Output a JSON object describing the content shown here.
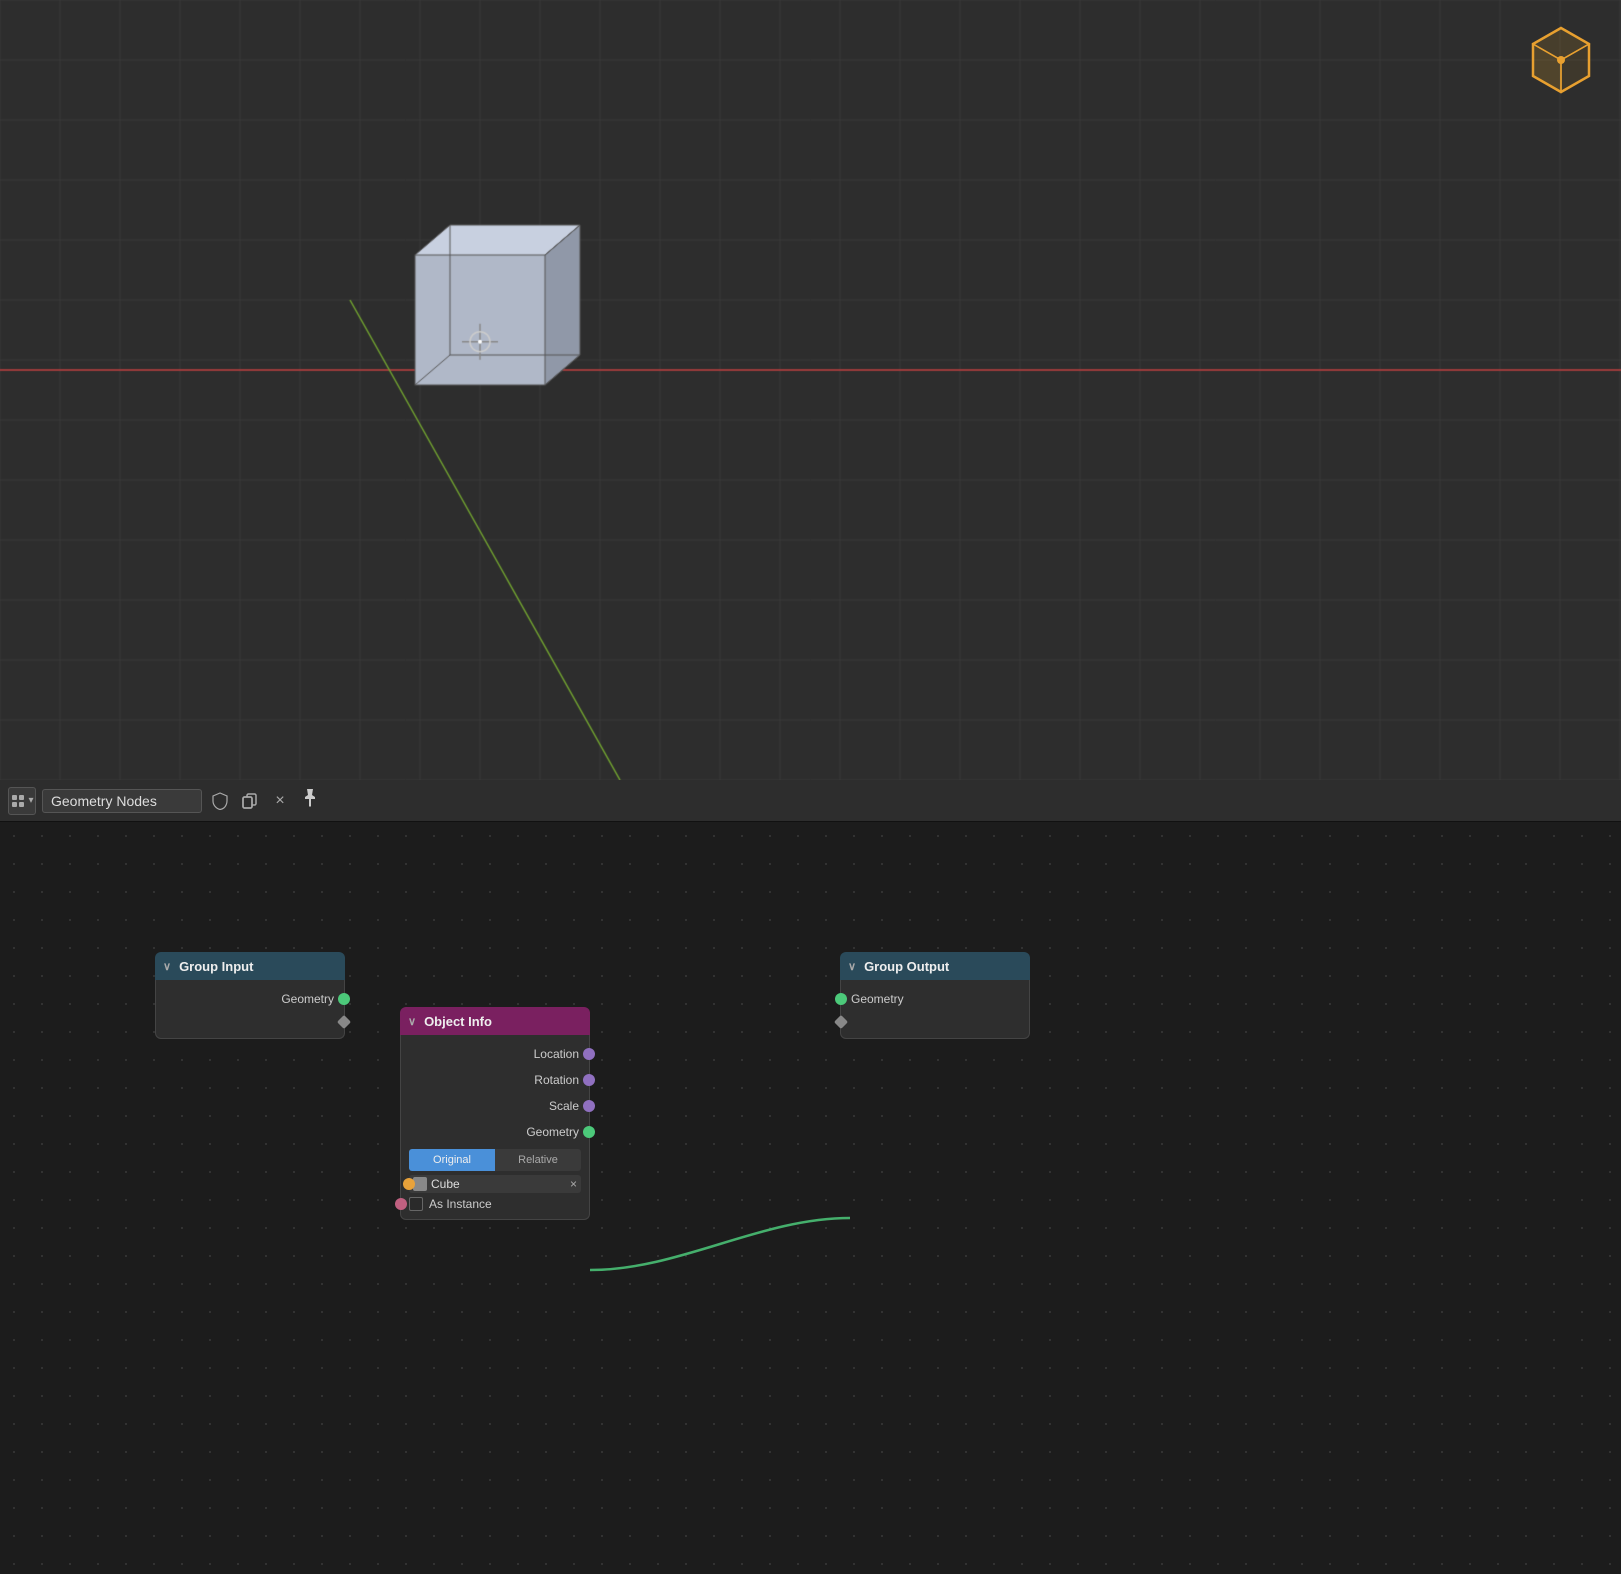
{
  "viewport": {
    "background_color": "#2a2a2a",
    "grid_color": "#3a3a3a",
    "axis_x_color": "#c04040",
    "axis_y_color": "#70a030",
    "axis_z_color": "#4060c0"
  },
  "node_editor": {
    "header": {
      "editor_type_label": "🖧",
      "nodetree_name": "Geometry Nodes",
      "shield_icon": "🛡",
      "copy_icon": "⧉",
      "close_icon": "×",
      "pin_icon": "📌"
    },
    "nodes": {
      "group_input": {
        "title": "Group Input",
        "chevron": "∨",
        "output_geometry_label": "Geometry",
        "output_extra_label": ""
      },
      "group_output": {
        "title": "Group Output",
        "chevron": "∨",
        "input_geometry_label": "Geometry",
        "input_extra_label": ""
      },
      "object_info": {
        "title": "Object Info",
        "chevron": "∨",
        "output_location_label": "Location",
        "output_rotation_label": "Rotation",
        "output_scale_label": "Scale",
        "output_geometry_label": "Geometry",
        "btn_original_label": "Original",
        "btn_relative_label": "Relative",
        "cube_label": "Cube",
        "as_instance_label": "As Instance"
      }
    }
  }
}
